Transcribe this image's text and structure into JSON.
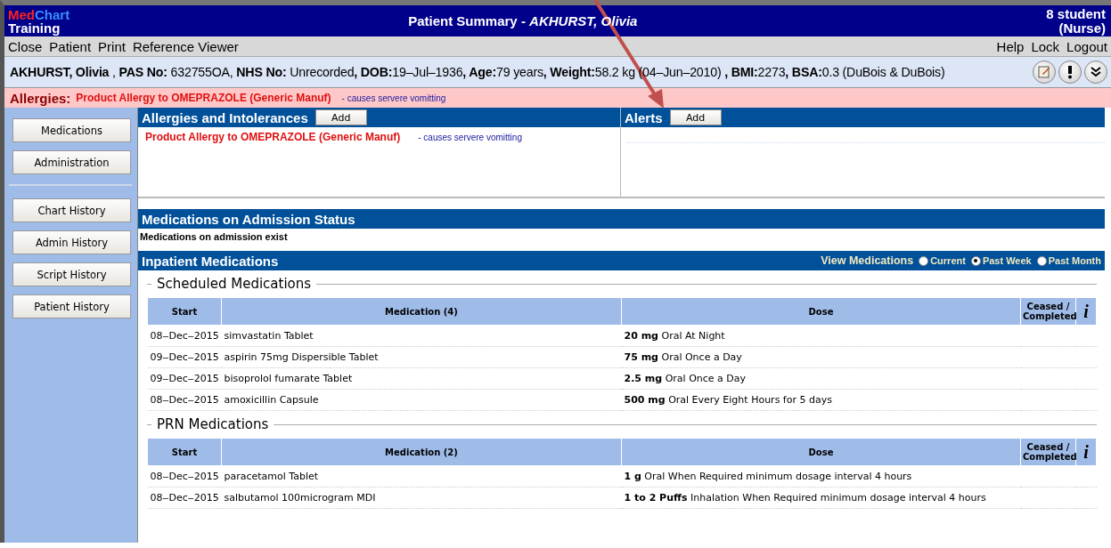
{
  "app": {
    "logo_part_1": "Med",
    "logo_part_2": "Chart",
    "logo_subtitle": "Training"
  },
  "window": {
    "title": "Patient Summary - *AKHURST, Olivia*",
    "user": "8 student",
    "role": "(Nurse)"
  },
  "menu_left": [
    "Close",
    "Patient",
    "Print",
    "Reference Viewer"
  ],
  "menu_right": [
    "Help",
    "Lock",
    "Logout"
  ],
  "patient_banner": "**AKHURST, Olivia** , **PAS No:** 632755OA, **NHS No:** Unrecorded**, DOB:**19‒Jul‒1936**, Age:**79 years**, Weight:**58.2 kg (04‒Jun‒2010) **, BMI:**2273**, BSA:**0.3 (DuBois & DuBois)",
  "allergy_bar": {
    "label": "Allergies:",
    "allergy": "Product Allergy to OMEPRAZOLE (Generic Manuf)",
    "reaction": "- causes servere vomitting"
  },
  "sidebar": {
    "groups": [
      [
        "Medications",
        "Administration"
      ],
      [
        "Chart History",
        "Admin History",
        "Script History",
        "Patient History"
      ]
    ]
  },
  "allergies_panel": {
    "title": "Allergies and Intolerances",
    "button": "Add",
    "items": [
      {
        "allergy": "Product Allergy to OMEPRAZOLE (Generic Manuf)",
        "reaction": "- causes servere vomitting"
      }
    ]
  },
  "alerts_panel": {
    "title": "Alerts",
    "button": "Add"
  },
  "admission_status": {
    "title": "Medications on Admission Status",
    "text": "Medications on admission exist"
  },
  "inpatient": {
    "title": "Inpatient Medications",
    "view_label": "View Medications",
    "options": [
      {
        "label": "Current",
        "selected": false
      },
      {
        "label": "Past Week",
        "selected": true
      },
      {
        "label": "Past Month",
        "selected": false
      }
    ],
    "sections": [
      {
        "title": "Scheduled Medications",
        "columns": [
          "Start",
          "Medication (4)",
          "Dose",
          "Ceased / Completed",
          "i"
        ],
        "rows": [
          {
            "start": "08‒Dec‒2015",
            "medication": "simvastatin Tablet",
            "dose": "**20 mg** Oral At Night"
          },
          {
            "start": "09‒Dec‒2015",
            "medication": "aspirin 75mg Dispersible Tablet",
            "dose": "**75 mg** Oral Once a Day"
          },
          {
            "start": "09‒Dec‒2015",
            "medication": "bisoprolol fumarate Tablet",
            "dose": "**2.5 mg** Oral Once a Day"
          },
          {
            "start": "08‒Dec‒2015",
            "medication": "amoxicillin Capsule",
            "dose": "**500 mg** Oral Every Eight Hours for 5 days"
          }
        ]
      },
      {
        "title": "PRN Medications",
        "columns": [
          "Start",
          "Medication (2)",
          "Dose",
          "Ceased / Completed",
          "i"
        ],
        "rows": [
          {
            "start": "08‒Dec‒2015",
            "medication": "paracetamol Tablet",
            "dose": "**1 g** Oral When Required minimum dosage interval 4 hours"
          },
          {
            "start": "08‒Dec‒2015",
            "medication": "salbutamol 100microgram MDI",
            "dose": "**1 to 2  Puffs** Inhalation When Required minimum dosage interval 4 hours"
          }
        ]
      }
    ]
  }
}
